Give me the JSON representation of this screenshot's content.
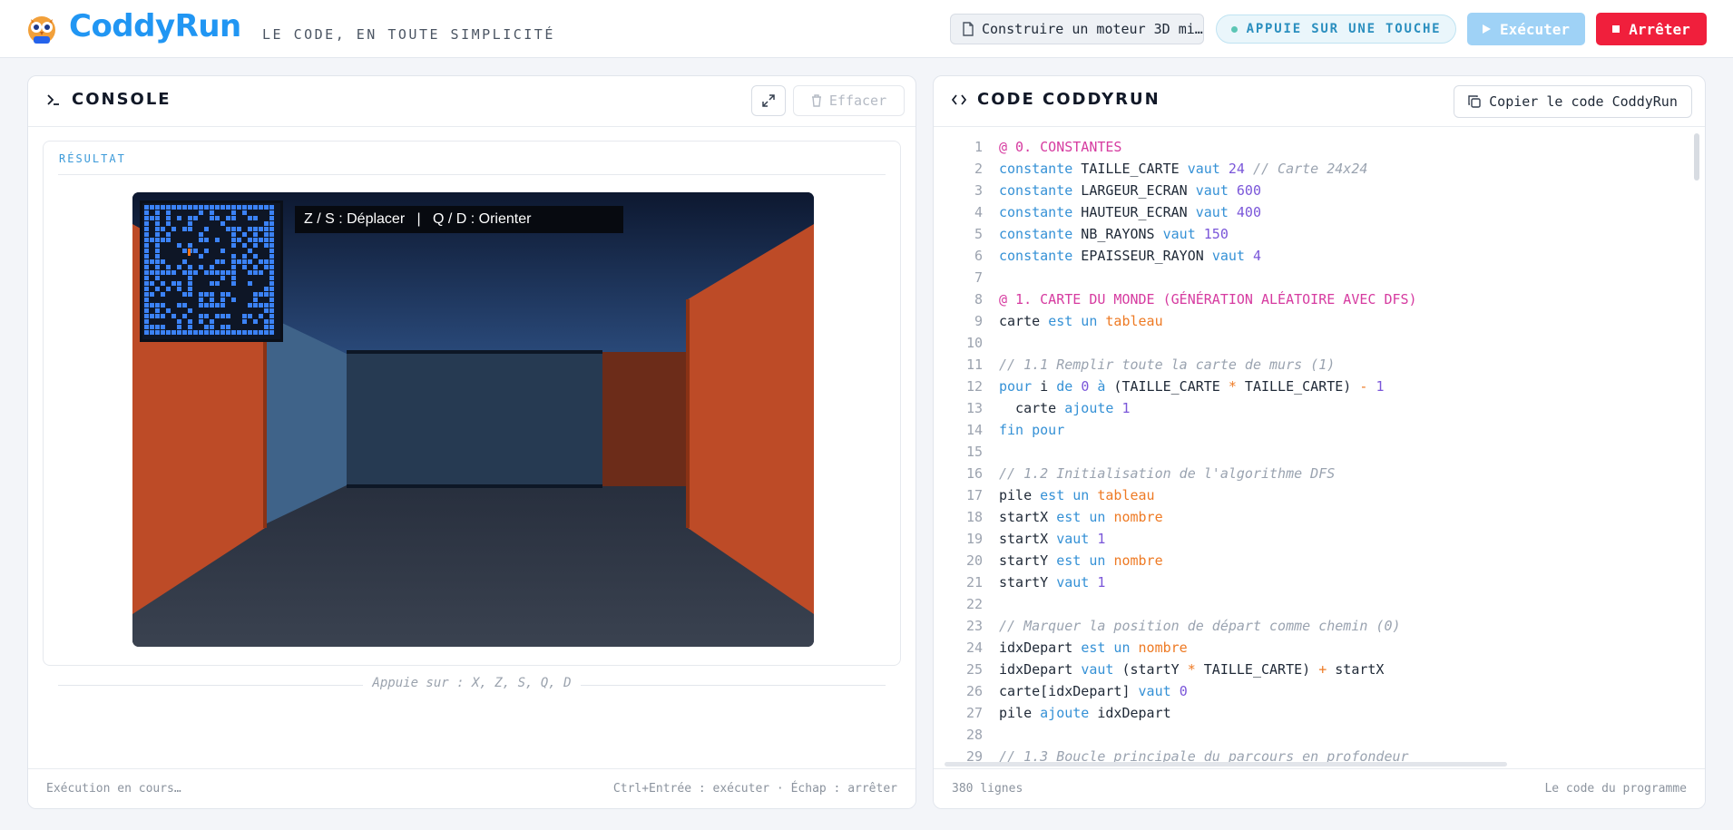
{
  "header": {
    "brand": "CoddyRun",
    "tagline": "LE CODE, EN TOUTE SIMPLICITÉ",
    "file_name": "Construire un moteur 3D mi…",
    "key_status": "APPUIE SUR UNE TOUCHE",
    "run_label": "Exécuter",
    "stop_label": "Arrêter"
  },
  "console": {
    "title": "CONSOLE",
    "clear_label": "Effacer",
    "result_label": "RÉSULTAT",
    "hud_text": "Z / S : Déplacer   |   Q / D : Orienter",
    "hint": "Appuie sur : X, Z, S, Q, D",
    "status": "Exécution en cours…",
    "shortcuts": "Ctrl+Entrée : exécuter · Échap : arrêter"
  },
  "code_panel": {
    "title": "CODE CODDYRUN",
    "copy_label": "Copier le code CoddyRun",
    "line_count": "380 lignes",
    "footer_right": "Le code du programme",
    "lines": [
      [
        [
          "sec",
          "@ 0. CONSTANTES"
        ]
      ],
      [
        [
          "kw",
          "constante"
        ],
        [
          "",
          " TAILLE_CARTE "
        ],
        [
          "kw",
          "vaut"
        ],
        [
          "",
          " "
        ],
        [
          "num",
          "24"
        ],
        [
          "",
          " "
        ],
        [
          "cmt",
          "// Carte 24x24"
        ]
      ],
      [
        [
          "kw",
          "constante"
        ],
        [
          "",
          " LARGEUR_ECRAN "
        ],
        [
          "kw",
          "vaut"
        ],
        [
          "",
          " "
        ],
        [
          "num",
          "600"
        ]
      ],
      [
        [
          "kw",
          "constante"
        ],
        [
          "",
          " HAUTEUR_ECRAN "
        ],
        [
          "kw",
          "vaut"
        ],
        [
          "",
          " "
        ],
        [
          "num",
          "400"
        ]
      ],
      [
        [
          "kw",
          "constante"
        ],
        [
          "",
          " NB_RAYONS "
        ],
        [
          "kw",
          "vaut"
        ],
        [
          "",
          " "
        ],
        [
          "num",
          "150"
        ]
      ],
      [
        [
          "kw",
          "constante"
        ],
        [
          "",
          " EPAISSEUR_RAYON "
        ],
        [
          "kw",
          "vaut"
        ],
        [
          "",
          " "
        ],
        [
          "num",
          "4"
        ]
      ],
      [],
      [
        [
          "sec",
          "@ 1. CARTE DU MONDE (GÉNÉRATION ALÉATOIRE AVEC DFS)"
        ]
      ],
      [
        [
          "",
          "carte "
        ],
        [
          "kw",
          "est un"
        ],
        [
          "",
          " "
        ],
        [
          "type",
          "tableau"
        ]
      ],
      [],
      [
        [
          "cmt",
          "// 1.1 Remplir toute la carte de murs (1)"
        ]
      ],
      [
        [
          "kw",
          "pour"
        ],
        [
          "",
          " i "
        ],
        [
          "kw",
          "de"
        ],
        [
          "",
          " "
        ],
        [
          "num",
          "0"
        ],
        [
          "",
          " "
        ],
        [
          "kw",
          "à"
        ],
        [
          "",
          " (TAILLE_CARTE "
        ],
        [
          "op",
          "*"
        ],
        [
          "",
          " TAILLE_CARTE) "
        ],
        [
          "op",
          "-"
        ],
        [
          "",
          " "
        ],
        [
          "num",
          "1"
        ]
      ],
      [
        [
          "",
          "  carte "
        ],
        [
          "kw",
          "ajoute"
        ],
        [
          "",
          " "
        ],
        [
          "num",
          "1"
        ]
      ],
      [
        [
          "kw",
          "fin pour"
        ]
      ],
      [],
      [
        [
          "cmt",
          "// 1.2 Initialisation de l'algorithme DFS"
        ]
      ],
      [
        [
          "",
          "pile "
        ],
        [
          "kw",
          "est un"
        ],
        [
          "",
          " "
        ],
        [
          "type",
          "tableau"
        ]
      ],
      [
        [
          "",
          "startX "
        ],
        [
          "kw",
          "est un"
        ],
        [
          "",
          " "
        ],
        [
          "type",
          "nombre"
        ]
      ],
      [
        [
          "",
          "startX "
        ],
        [
          "kw",
          "vaut"
        ],
        [
          "",
          " "
        ],
        [
          "num",
          "1"
        ]
      ],
      [
        [
          "",
          "startY "
        ],
        [
          "kw",
          "est un"
        ],
        [
          "",
          " "
        ],
        [
          "type",
          "nombre"
        ]
      ],
      [
        [
          "",
          "startY "
        ],
        [
          "kw",
          "vaut"
        ],
        [
          "",
          " "
        ],
        [
          "num",
          "1"
        ]
      ],
      [],
      [
        [
          "cmt",
          "// Marquer la position de départ comme chemin (0)"
        ]
      ],
      [
        [
          "",
          "idxDepart "
        ],
        [
          "kw",
          "est un"
        ],
        [
          "",
          " "
        ],
        [
          "type",
          "nombre"
        ]
      ],
      [
        [
          "",
          "idxDepart "
        ],
        [
          "kw",
          "vaut"
        ],
        [
          "",
          " (startY "
        ],
        [
          "op",
          "*"
        ],
        [
          "",
          " TAILLE_CARTE) "
        ],
        [
          "op",
          "+"
        ],
        [
          "",
          " startX"
        ]
      ],
      [
        [
          "",
          "carte[idxDepart] "
        ],
        [
          "kw",
          "vaut"
        ],
        [
          "",
          " "
        ],
        [
          "num",
          "0"
        ]
      ],
      [
        [
          "",
          "pile "
        ],
        [
          "kw",
          "ajoute"
        ],
        [
          "",
          " idxDepart"
        ]
      ],
      [],
      [
        [
          "cmt",
          "// 1.3 Boucle principale du parcours en profondeur"
        ]
      ]
    ]
  },
  "colors": {
    "brand": "#2196f3",
    "run_button": "#9fd2f6",
    "stop_button": "#f01f3c",
    "wall_front": "#bd4b27",
    "wall_side": "#3e5f86",
    "minimap_wall": "#3b82f6"
  },
  "icons": {
    "logo": "owl-mascot-icon",
    "file": "file-icon",
    "run": "play-icon",
    "stop": "stop-icon",
    "console": "terminal-prompt-icon",
    "expand": "expand-arrows-icon",
    "clear": "trash-icon",
    "code": "code-brackets-icon",
    "copy": "copy-icon"
  }
}
